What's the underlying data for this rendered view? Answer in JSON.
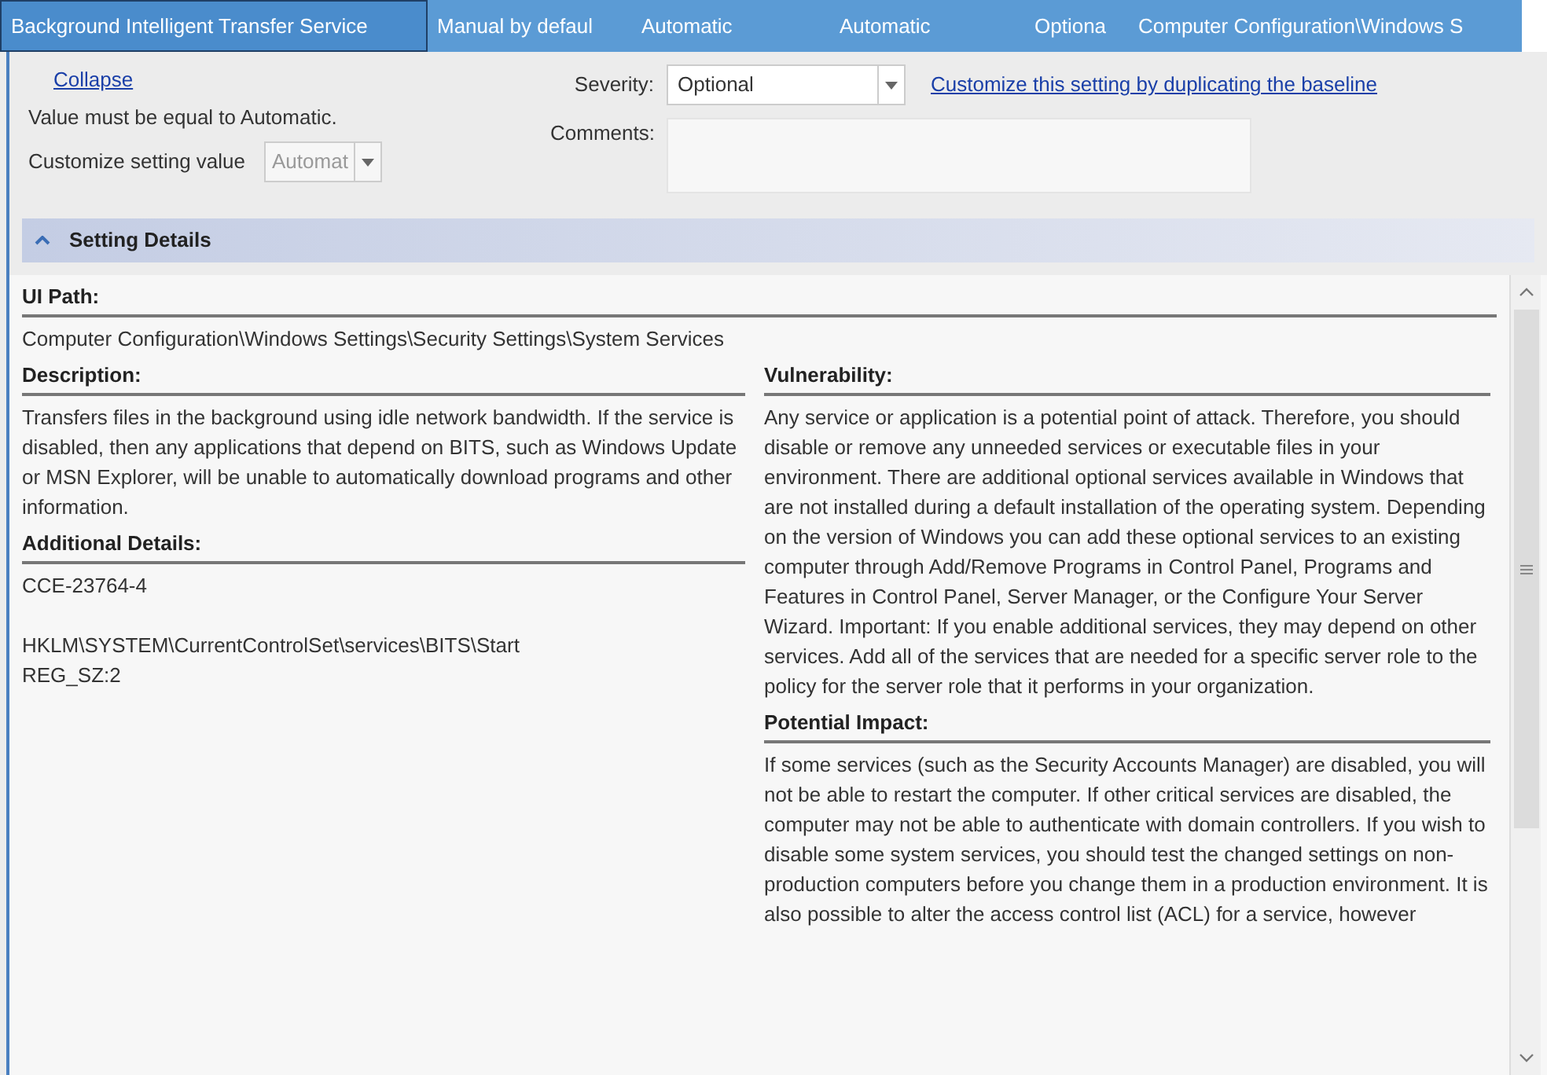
{
  "header_row": [
    {
      "text": "Background Intelligent Transfer Service",
      "selected": true
    },
    {
      "text": "Manual by defaul",
      "selected": false
    },
    {
      "text": "Automatic",
      "selected": false
    },
    {
      "text": "Automatic",
      "selected": false
    },
    {
      "text": "Optiona",
      "selected": false
    },
    {
      "text": "Computer Configuration\\Windows S",
      "selected": false
    }
  ],
  "panel": {
    "collapse_link": "Collapse",
    "rule_text": "Value must be equal to Automatic.",
    "customize_label": "Customize setting value",
    "customize_value": {
      "value": "Automat",
      "disabled": true
    },
    "severity_label": "Severity:",
    "severity_value": "Optional",
    "customize_link": "Customize this setting by duplicating the baseline",
    "comments_label": "Comments:"
  },
  "section": {
    "title": "Setting Details",
    "expanded": true
  },
  "details": {
    "ui_path_label": "UI Path:",
    "ui_path": "Computer Configuration\\Windows Settings\\Security Settings\\System Services",
    "description_label": "Description:",
    "description": "Transfers files in the background using idle network bandwidth. If the service is disabled, then any applications that depend on BITS, such as Windows Update or MSN Explorer, will be unable to automatically download programs and other information.",
    "additional_label": "Additional Details:",
    "additional_lines": [
      "CCE-23764-4"
    ],
    "registry_lines": [
      "HKLM\\SYSTEM\\CurrentControlSet\\services\\BITS\\Start",
      "REG_SZ:2"
    ],
    "vulnerability_label": "Vulnerability:",
    "vulnerability": "Any service or application is a potential point of attack. Therefore, you should disable or remove any unneeded services or executable files in your environment. There are additional optional services available in Windows that are not installed during a default installation of the operating system. Depending on the version of Windows you can add these optional services to an existing computer through Add/Remove Programs in Control Panel, Programs and Features in Control Panel, Server Manager, or the Configure Your Server Wizard. Important: If you enable additional services, they may depend on other services. Add all of the services that are needed for a specific server role to the policy for the server role that it performs in your organization.",
    "impact_label": "Potential Impact:",
    "impact": "If some services (such as the Security Accounts Manager) are disabled, you will not be able to restart the computer. If other critical services are disabled, the computer may not be able to authenticate with domain controllers. If you wish to disable some system services, you should test the changed settings on non-production computers before you change them in a production environment. It is also possible to alter the access control list (ACL) for a service, however"
  }
}
